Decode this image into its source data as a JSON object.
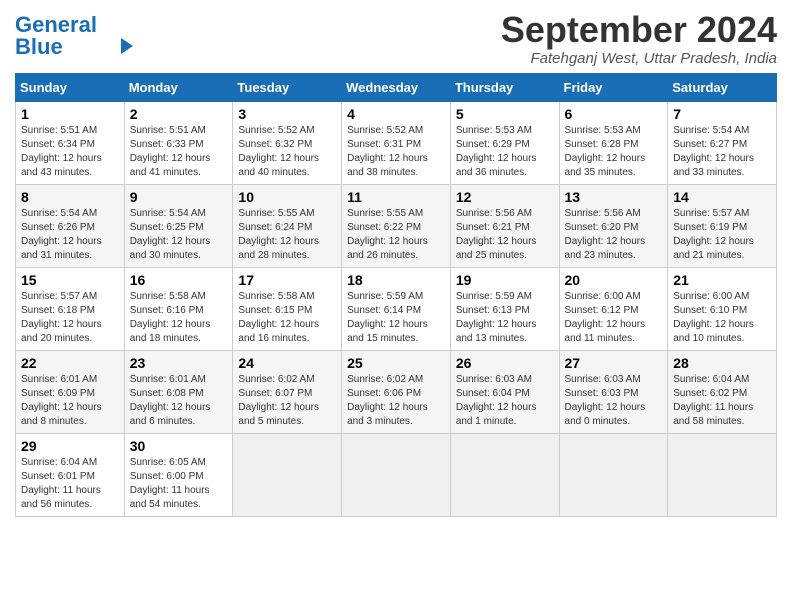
{
  "header": {
    "logo_line1": "General",
    "logo_line2": "Blue",
    "month_title": "September 2024",
    "location": "Fatehganj West, Uttar Pradesh, India"
  },
  "columns": [
    "Sunday",
    "Monday",
    "Tuesday",
    "Wednesday",
    "Thursday",
    "Friday",
    "Saturday"
  ],
  "weeks": [
    [
      {
        "day": "1",
        "sunrise": "Sunrise: 5:51 AM",
        "sunset": "Sunset: 6:34 PM",
        "daylight": "Daylight: 12 hours and 43 minutes."
      },
      {
        "day": "2",
        "sunrise": "Sunrise: 5:51 AM",
        "sunset": "Sunset: 6:33 PM",
        "daylight": "Daylight: 12 hours and 41 minutes."
      },
      {
        "day": "3",
        "sunrise": "Sunrise: 5:52 AM",
        "sunset": "Sunset: 6:32 PM",
        "daylight": "Daylight: 12 hours and 40 minutes."
      },
      {
        "day": "4",
        "sunrise": "Sunrise: 5:52 AM",
        "sunset": "Sunset: 6:31 PM",
        "daylight": "Daylight: 12 hours and 38 minutes."
      },
      {
        "day": "5",
        "sunrise": "Sunrise: 5:53 AM",
        "sunset": "Sunset: 6:29 PM",
        "daylight": "Daylight: 12 hours and 36 minutes."
      },
      {
        "day": "6",
        "sunrise": "Sunrise: 5:53 AM",
        "sunset": "Sunset: 6:28 PM",
        "daylight": "Daylight: 12 hours and 35 minutes."
      },
      {
        "day": "7",
        "sunrise": "Sunrise: 5:54 AM",
        "sunset": "Sunset: 6:27 PM",
        "daylight": "Daylight: 12 hours and 33 minutes."
      }
    ],
    [
      {
        "day": "8",
        "sunrise": "Sunrise: 5:54 AM",
        "sunset": "Sunset: 6:26 PM",
        "daylight": "Daylight: 12 hours and 31 minutes."
      },
      {
        "day": "9",
        "sunrise": "Sunrise: 5:54 AM",
        "sunset": "Sunset: 6:25 PM",
        "daylight": "Daylight: 12 hours and 30 minutes."
      },
      {
        "day": "10",
        "sunrise": "Sunrise: 5:55 AM",
        "sunset": "Sunset: 6:24 PM",
        "daylight": "Daylight: 12 hours and 28 minutes."
      },
      {
        "day": "11",
        "sunrise": "Sunrise: 5:55 AM",
        "sunset": "Sunset: 6:22 PM",
        "daylight": "Daylight: 12 hours and 26 minutes."
      },
      {
        "day": "12",
        "sunrise": "Sunrise: 5:56 AM",
        "sunset": "Sunset: 6:21 PM",
        "daylight": "Daylight: 12 hours and 25 minutes."
      },
      {
        "day": "13",
        "sunrise": "Sunrise: 5:56 AM",
        "sunset": "Sunset: 6:20 PM",
        "daylight": "Daylight: 12 hours and 23 minutes."
      },
      {
        "day": "14",
        "sunrise": "Sunrise: 5:57 AM",
        "sunset": "Sunset: 6:19 PM",
        "daylight": "Daylight: 12 hours and 21 minutes."
      }
    ],
    [
      {
        "day": "15",
        "sunrise": "Sunrise: 5:57 AM",
        "sunset": "Sunset: 6:18 PM",
        "daylight": "Daylight: 12 hours and 20 minutes."
      },
      {
        "day": "16",
        "sunrise": "Sunrise: 5:58 AM",
        "sunset": "Sunset: 6:16 PM",
        "daylight": "Daylight: 12 hours and 18 minutes."
      },
      {
        "day": "17",
        "sunrise": "Sunrise: 5:58 AM",
        "sunset": "Sunset: 6:15 PM",
        "daylight": "Daylight: 12 hours and 16 minutes."
      },
      {
        "day": "18",
        "sunrise": "Sunrise: 5:59 AM",
        "sunset": "Sunset: 6:14 PM",
        "daylight": "Daylight: 12 hours and 15 minutes."
      },
      {
        "day": "19",
        "sunrise": "Sunrise: 5:59 AM",
        "sunset": "Sunset: 6:13 PM",
        "daylight": "Daylight: 12 hours and 13 minutes."
      },
      {
        "day": "20",
        "sunrise": "Sunrise: 6:00 AM",
        "sunset": "Sunset: 6:12 PM",
        "daylight": "Daylight: 12 hours and 11 minutes."
      },
      {
        "day": "21",
        "sunrise": "Sunrise: 6:00 AM",
        "sunset": "Sunset: 6:10 PM",
        "daylight": "Daylight: 12 hours and 10 minutes."
      }
    ],
    [
      {
        "day": "22",
        "sunrise": "Sunrise: 6:01 AM",
        "sunset": "Sunset: 6:09 PM",
        "daylight": "Daylight: 12 hours and 8 minutes."
      },
      {
        "day": "23",
        "sunrise": "Sunrise: 6:01 AM",
        "sunset": "Sunset: 6:08 PM",
        "daylight": "Daylight: 12 hours and 6 minutes."
      },
      {
        "day": "24",
        "sunrise": "Sunrise: 6:02 AM",
        "sunset": "Sunset: 6:07 PM",
        "daylight": "Daylight: 12 hours and 5 minutes."
      },
      {
        "day": "25",
        "sunrise": "Sunrise: 6:02 AM",
        "sunset": "Sunset: 6:06 PM",
        "daylight": "Daylight: 12 hours and 3 minutes."
      },
      {
        "day": "26",
        "sunrise": "Sunrise: 6:03 AM",
        "sunset": "Sunset: 6:04 PM",
        "daylight": "Daylight: 12 hours and 1 minute."
      },
      {
        "day": "27",
        "sunrise": "Sunrise: 6:03 AM",
        "sunset": "Sunset: 6:03 PM",
        "daylight": "Daylight: 12 hours and 0 minutes."
      },
      {
        "day": "28",
        "sunrise": "Sunrise: 6:04 AM",
        "sunset": "Sunset: 6:02 PM",
        "daylight": "Daylight: 11 hours and 58 minutes."
      }
    ],
    [
      {
        "day": "29",
        "sunrise": "Sunrise: 6:04 AM",
        "sunset": "Sunset: 6:01 PM",
        "daylight": "Daylight: 11 hours and 56 minutes."
      },
      {
        "day": "30",
        "sunrise": "Sunrise: 6:05 AM",
        "sunset": "Sunset: 6:00 PM",
        "daylight": "Daylight: 11 hours and 54 minutes."
      },
      null,
      null,
      null,
      null,
      null
    ]
  ]
}
